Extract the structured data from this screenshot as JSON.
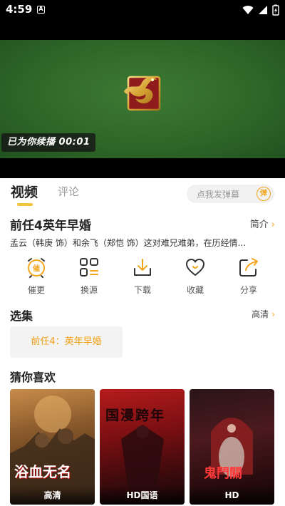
{
  "status_bar": {
    "time": "4:59",
    "notification_icon": "A"
  },
  "player": {
    "resume_text": "已为你续播 00:01"
  },
  "tabs": {
    "video": "视频",
    "comments": "评论"
  },
  "danmu": {
    "placeholder": "点我发弹幕",
    "button": "弹"
  },
  "show": {
    "title": "前任4英年早婚",
    "intro_label": "简介",
    "description": "孟云（韩庚 饰）和余飞（郑恺 饰）这对难兄难弟，在历经情..."
  },
  "actions": [
    {
      "label": "催更",
      "icon": "alarm-clock-icon",
      "glyph": "催"
    },
    {
      "label": "换源",
      "icon": "grid-icon"
    },
    {
      "label": "下载",
      "icon": "download-icon"
    },
    {
      "label": "收藏",
      "icon": "heart-icon"
    },
    {
      "label": "分享",
      "icon": "share-icon"
    }
  ],
  "episodes": {
    "section_title": "选集",
    "quality": "高清",
    "items": [
      "前任4：英年早婚"
    ]
  },
  "recommendations": {
    "section_title": "猜你喜欢",
    "items": [
      {
        "badge": "高清",
        "poster_text": "浴血无名"
      },
      {
        "badge": "HD国语",
        "poster_text": "国漫跨年"
      },
      {
        "badge": "HD",
        "poster_text": "鬼門關"
      }
    ]
  },
  "colors": {
    "accent": "#f3a61c",
    "video_bg": "#2f6729"
  }
}
